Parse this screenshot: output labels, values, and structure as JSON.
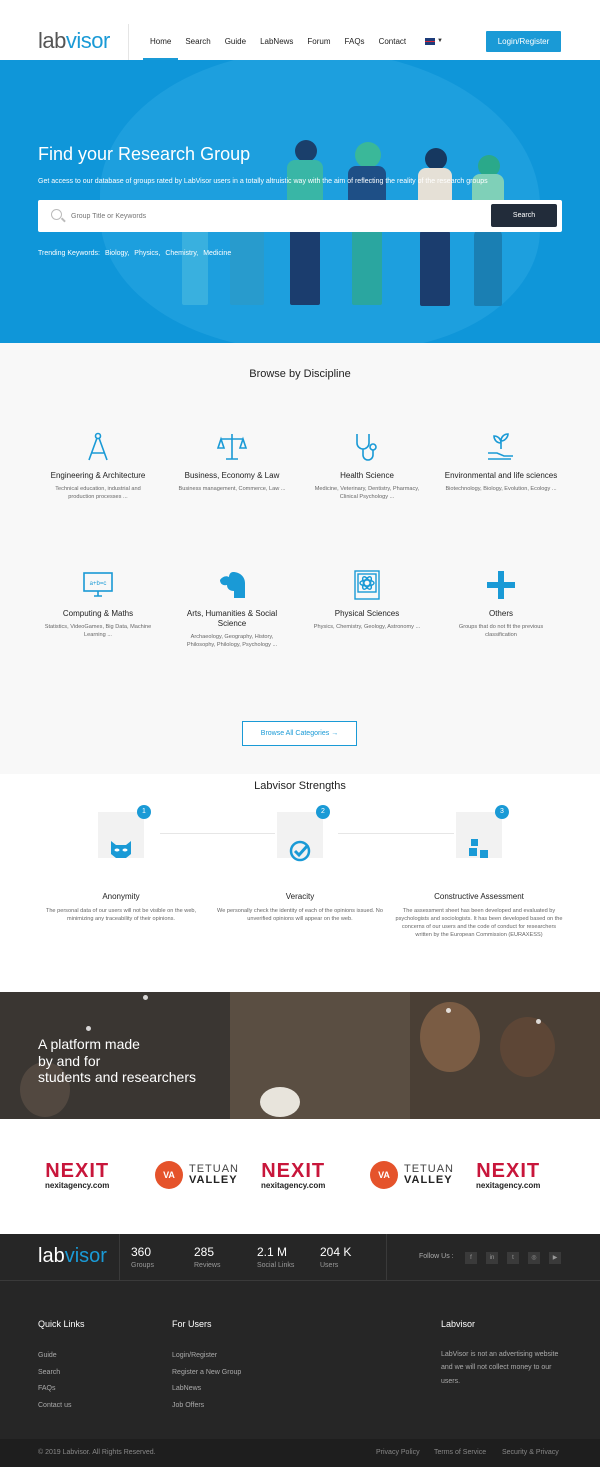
{
  "brand": {
    "logo_a": "lab",
    "logo_b": "visor"
  },
  "nav": {
    "items": [
      {
        "label": "Home"
      },
      {
        "label": "Search"
      },
      {
        "label": "Guide"
      },
      {
        "label": "LabNews"
      },
      {
        "label": "Forum"
      },
      {
        "label": "FAQs"
      },
      {
        "label": "Contact"
      }
    ],
    "login_label": "Login/Register"
  },
  "hero": {
    "title": "Find your Research Group",
    "subtitle": "Get access to our database of groups rated by LabVisor users in a totally altruistic way with the aim of reflecting the reality of the research groups",
    "search_placeholder": "Group Title or Keywords",
    "search_button": "Search",
    "trending_label": "Trending Keywords:",
    "trending": [
      "Biology,",
      "Physics,",
      "Chemistry,",
      "Medicine"
    ]
  },
  "browse": {
    "title": "Browse by Discipline",
    "categories": [
      {
        "name": "Engineering & Architecture",
        "desc": "Technical education, industrial and production processes ..."
      },
      {
        "name": "Business, Economy & Law",
        "desc": "Business management, Commerce, Law ..."
      },
      {
        "name": "Health Science",
        "desc": "Medicine, Veterinary, Dentistry, Pharmacy, Clinical Psychology ..."
      },
      {
        "name": "Environmental and life sciences",
        "desc": "Biotechnology, Biology, Evolution, Ecology ..."
      },
      {
        "name": "Computing & Maths",
        "desc": "Statistics, VideoGames, Big Data, Machine Learning ..."
      },
      {
        "name": "Arts, Humanities & Social Science",
        "desc": "Archaeology, Geography, History, Philosophy, Philology, Psychology ..."
      },
      {
        "name": "Physical Sciences",
        "desc": "Physics, Chemistry, Geology, Astronomy ..."
      },
      {
        "name": "Others",
        "desc": "Groups that do not fit the previous classification"
      }
    ],
    "browse_all": "Browse All Categories →"
  },
  "strengths": {
    "title": "Labvisor Strengths",
    "items": [
      {
        "num": "1",
        "name": "Anonymity",
        "desc": "The personal data of our users will not be visible on the web, minimizing any traceability of their opinions."
      },
      {
        "num": "2",
        "name": "Veracity",
        "desc": "We personally check the identity of each of the opinions issued. No unverified opinions will appear on the web."
      },
      {
        "num": "3",
        "name": "Constructive Assessment",
        "desc": "The assessment sheet has been developed and evaluated by psychologists and sociologists. It has been developed based on the concerns of our users and the code of conduct for researchers written by the European Commission (EURAXESS)"
      }
    ]
  },
  "banner": {
    "line1": "A platform made",
    "line2": "by and for",
    "line3": "students and researchers"
  },
  "partners": {
    "nexit_top": "NEXIT",
    "nexit_bottom": "nexitagency.com",
    "tv_badge": "VA",
    "tv_line1": "TETUAN",
    "tv_line2": "VALLEY"
  },
  "stats": {
    "items": [
      {
        "value": "360",
        "label": "Groups"
      },
      {
        "value": "285",
        "label": "Reviews"
      },
      {
        "value": "2.1 M",
        "label": "Social Links"
      },
      {
        "value": "204 K",
        "label": "Users"
      }
    ],
    "follow_label": "Follow Us :"
  },
  "footer": {
    "quick_title": "Quick Links",
    "quick_links": [
      "Guide",
      "Search",
      "FAQs",
      "Contact us"
    ],
    "users_title": "For Users",
    "users_links": [
      "Login/Register",
      "Register a New Group",
      "LabNews",
      "Job Offers"
    ],
    "about_title": "Labvisor",
    "about_text": "LabVisor is not an advertising website and we will not collect money to our users.",
    "copyright": "© 2019 Labvisor. All Rights Reserved.",
    "legal": [
      "Privacy Policy",
      "Terms of Service",
      "Security & Privacy"
    ]
  },
  "colors": {
    "accent": "#1a9ad6",
    "dark": "#262626",
    "nexit": "#c8163b",
    "tetuan": "#e5532b"
  }
}
